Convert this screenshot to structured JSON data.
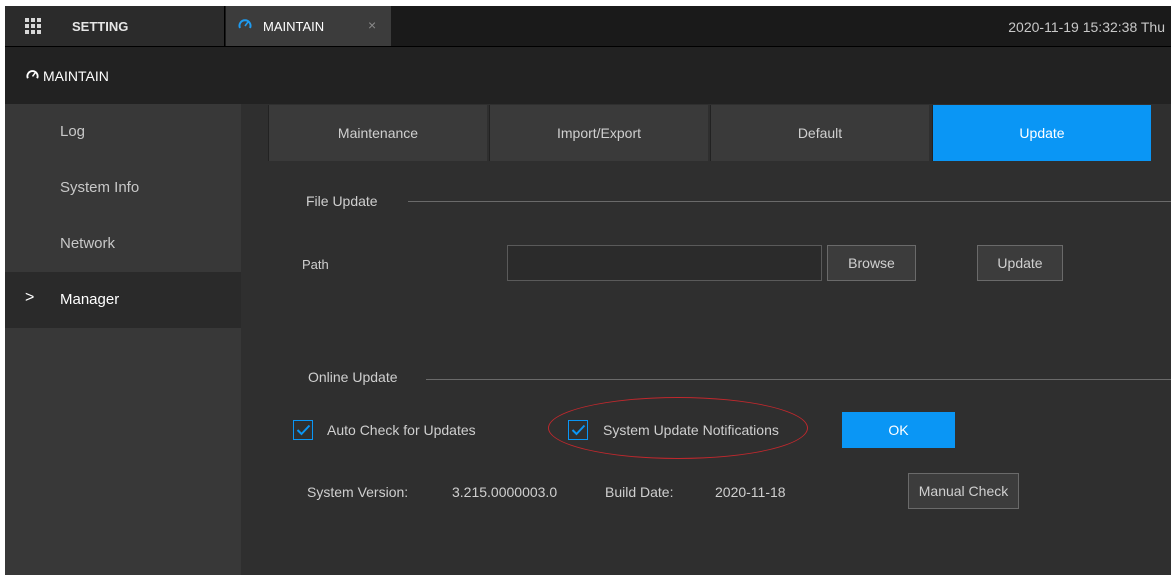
{
  "topbar": {
    "setting_label": "SETTING",
    "maintain_tab_label": "MAINTAIN",
    "close_glyph": "×",
    "datetime": "2020-11-19 15:32:38 Thu"
  },
  "titlebar": {
    "title": "MAINTAIN"
  },
  "sidebar": {
    "items": [
      {
        "label": "Log"
      },
      {
        "label": "System Info"
      },
      {
        "label": "Network"
      },
      {
        "label": "Manager",
        "active": true
      }
    ],
    "active_chevron": ">"
  },
  "tabs": [
    {
      "label": "Maintenance"
    },
    {
      "label": "Import/Export"
    },
    {
      "label": "Default"
    },
    {
      "label": "Update",
      "active": true
    }
  ],
  "file_update": {
    "title": "File Update",
    "path_label": "Path",
    "path_value": "",
    "browse_label": "Browse",
    "update_label": "Update"
  },
  "online_update": {
    "title": "Online Update",
    "auto_check_label": "Auto Check for Updates",
    "auto_check_checked": true,
    "notifications_label": "System Update Notifications",
    "notifications_checked": true,
    "ok_label": "OK",
    "system_version_label": "System Version:",
    "system_version_value": "3.215.0000003.0",
    "build_date_label": "Build Date:",
    "build_date_value": "2020-11-18",
    "manual_check_label": "Manual Check"
  },
  "icons": {
    "grid": "grid-icon",
    "maintain": "gauge-icon",
    "close": "close-icon",
    "chevron": "chevron-right-icon",
    "checkmark": "checkmark-icon"
  },
  "colors": {
    "accent": "#0a96f5",
    "highlight": "#c0282d",
    "background": "#2f2f2f",
    "sidebar": "#383838"
  }
}
